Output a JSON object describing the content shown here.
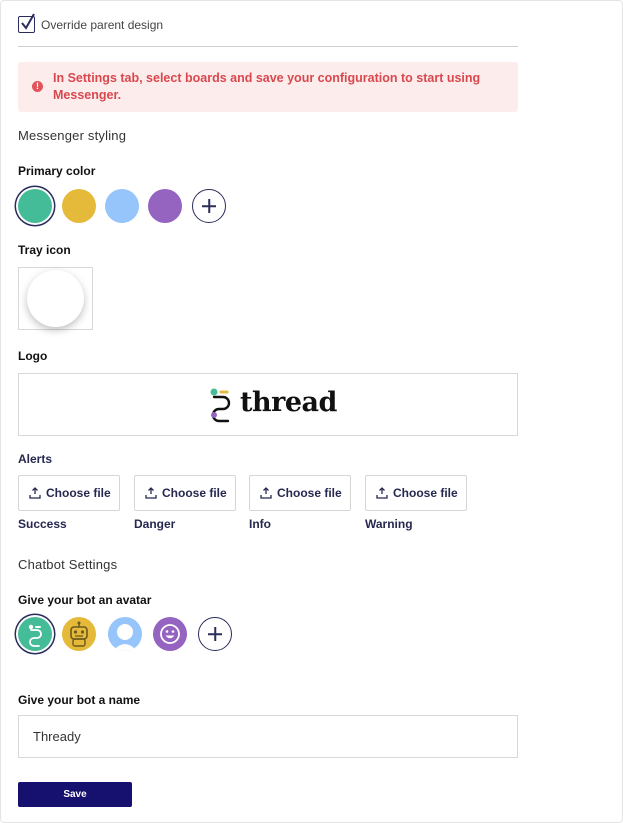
{
  "override": {
    "label": "Override parent design",
    "checked": true
  },
  "alert": {
    "icon": "exclamation-icon",
    "text": "In Settings tab, select boards and save your configuration to start using Messenger."
  },
  "messenger_styling": {
    "title": "Messenger styling",
    "primary_color_label": "Primary color",
    "colors": [
      "#44bc98",
      "#e5b93a",
      "#96c5fb",
      "#9563c0"
    ],
    "selected_color_index": 0,
    "tray_icon_label": "Tray icon",
    "logo_label": "Logo",
    "logo_text": "thread"
  },
  "alerts": {
    "label": "Alerts",
    "items": [
      {
        "button": "Choose file",
        "caption": "Success"
      },
      {
        "button": "Choose file",
        "caption": "Danger"
      },
      {
        "button": "Choose file",
        "caption": "Info"
      },
      {
        "button": "Choose file",
        "caption": "Warning"
      }
    ]
  },
  "chatbot": {
    "title": "Chatbot Settings",
    "avatar_label": "Give your bot an avatar",
    "avatars": [
      "thread-logo-icon",
      "robot-icon",
      "user-silhouette-icon",
      "smiley-icon"
    ],
    "selected_avatar_index": 0,
    "name_label": "Give your bot a name",
    "name_value": "Thready"
  },
  "save_label": "Save"
}
